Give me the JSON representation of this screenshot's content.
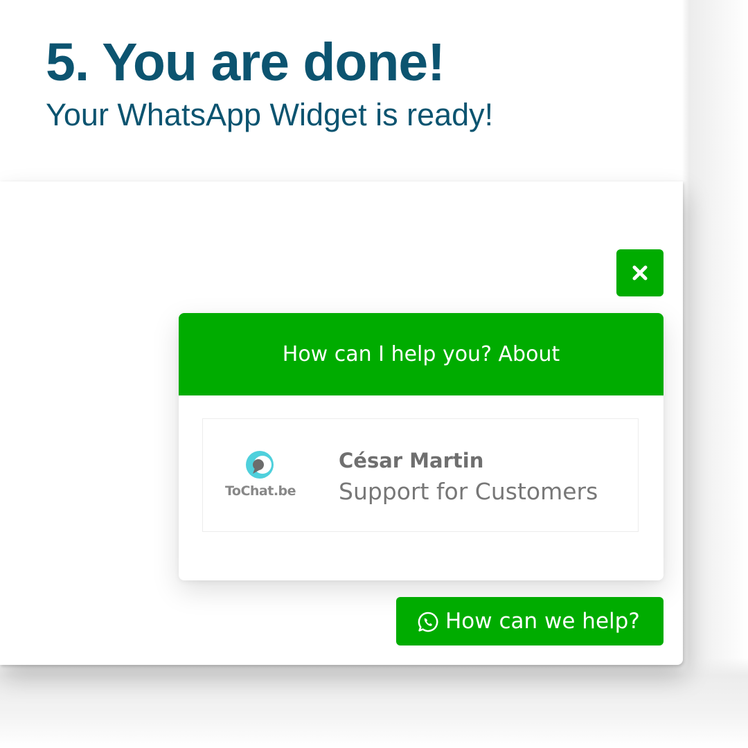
{
  "heading": {
    "title": "5. You are done!",
    "subtitle": "Your WhatsApp Widget is ready!"
  },
  "widget": {
    "accent_color": "#00ac00",
    "close_icon": "close-icon",
    "header_text": "How can I help you? About",
    "agent": {
      "logo_icon": "tochat-logo-icon",
      "logo_text": "ToChat.be",
      "name": "César Martin",
      "role": "Support for Customers"
    },
    "launcher": {
      "icon": "whatsapp-icon",
      "label": "How can we help?"
    }
  }
}
